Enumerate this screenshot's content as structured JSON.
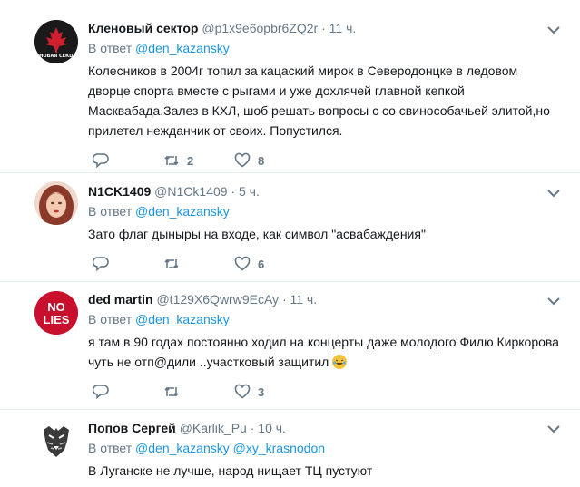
{
  "tweets": [
    {
      "name": "Кленовый сектор",
      "handle": "@p1x9e6opbr6ZQ2r",
      "sep": "·",
      "time": "11 ч.",
      "reply_prefix": "В ответ",
      "reply_to": [
        "@den_kazansky"
      ],
      "text": "Колесников в 2004г топил за кацаский мирок в Северодонцке в ледовом дворце спорта вместе с рыгами и уже дохлячей главной кепкой Масквабада.Залез в КХЛ, шоб решать вопросы с со свинособачьей элитой,но прилетел нежданчик от своих. Попустился.",
      "counts": {
        "reply": "",
        "retweet": "2",
        "like": "8"
      },
      "avatar_text": "НОВАЯ СЕКЦ"
    },
    {
      "name": "N1CK1409",
      "handle": "@N1Ck1409",
      "sep": "·",
      "time": "5 ч.",
      "reply_prefix": "В ответ",
      "reply_to": [
        "@den_kazansky"
      ],
      "text": "Зато флаг дыныры на входе, как символ \"асвабаждения\"",
      "counts": {
        "reply": "",
        "retweet": "",
        "like": "6"
      }
    },
    {
      "name": "ded martin",
      "handle": "@t129X6Qwrw9EcAy",
      "sep": "·",
      "time": "11 ч.",
      "reply_prefix": "В ответ",
      "reply_to": [
        "@den_kazansky"
      ],
      "text": "я там в 90 годах постоянно ходил на концерты даже молодого Филю Киркорова  чуть не отп@дили ..участковый защитил",
      "counts": {
        "reply": "",
        "retweet": "",
        "like": "3"
      },
      "avatar_line1": "NO",
      "avatar_line2": "LIES"
    },
    {
      "name": "Попов Сергей",
      "handle": "@Karlik_Pu",
      "sep": "·",
      "time": "10 ч.",
      "reply_prefix": "В ответ",
      "reply_to": [
        "@den_kazansky",
        "@xy_krasnodon"
      ],
      "text": "В Луганске не лучше, народ нищает ТЦ пустуют"
    }
  ],
  "icons": [
    "reply-icon",
    "retweet-icon",
    "like-icon",
    "chevron-down-icon"
  ],
  "colors": {
    "link": "#1b95e0",
    "secondary": "#657786",
    "divider": "#e6ecf0",
    "text": "#14171a"
  }
}
